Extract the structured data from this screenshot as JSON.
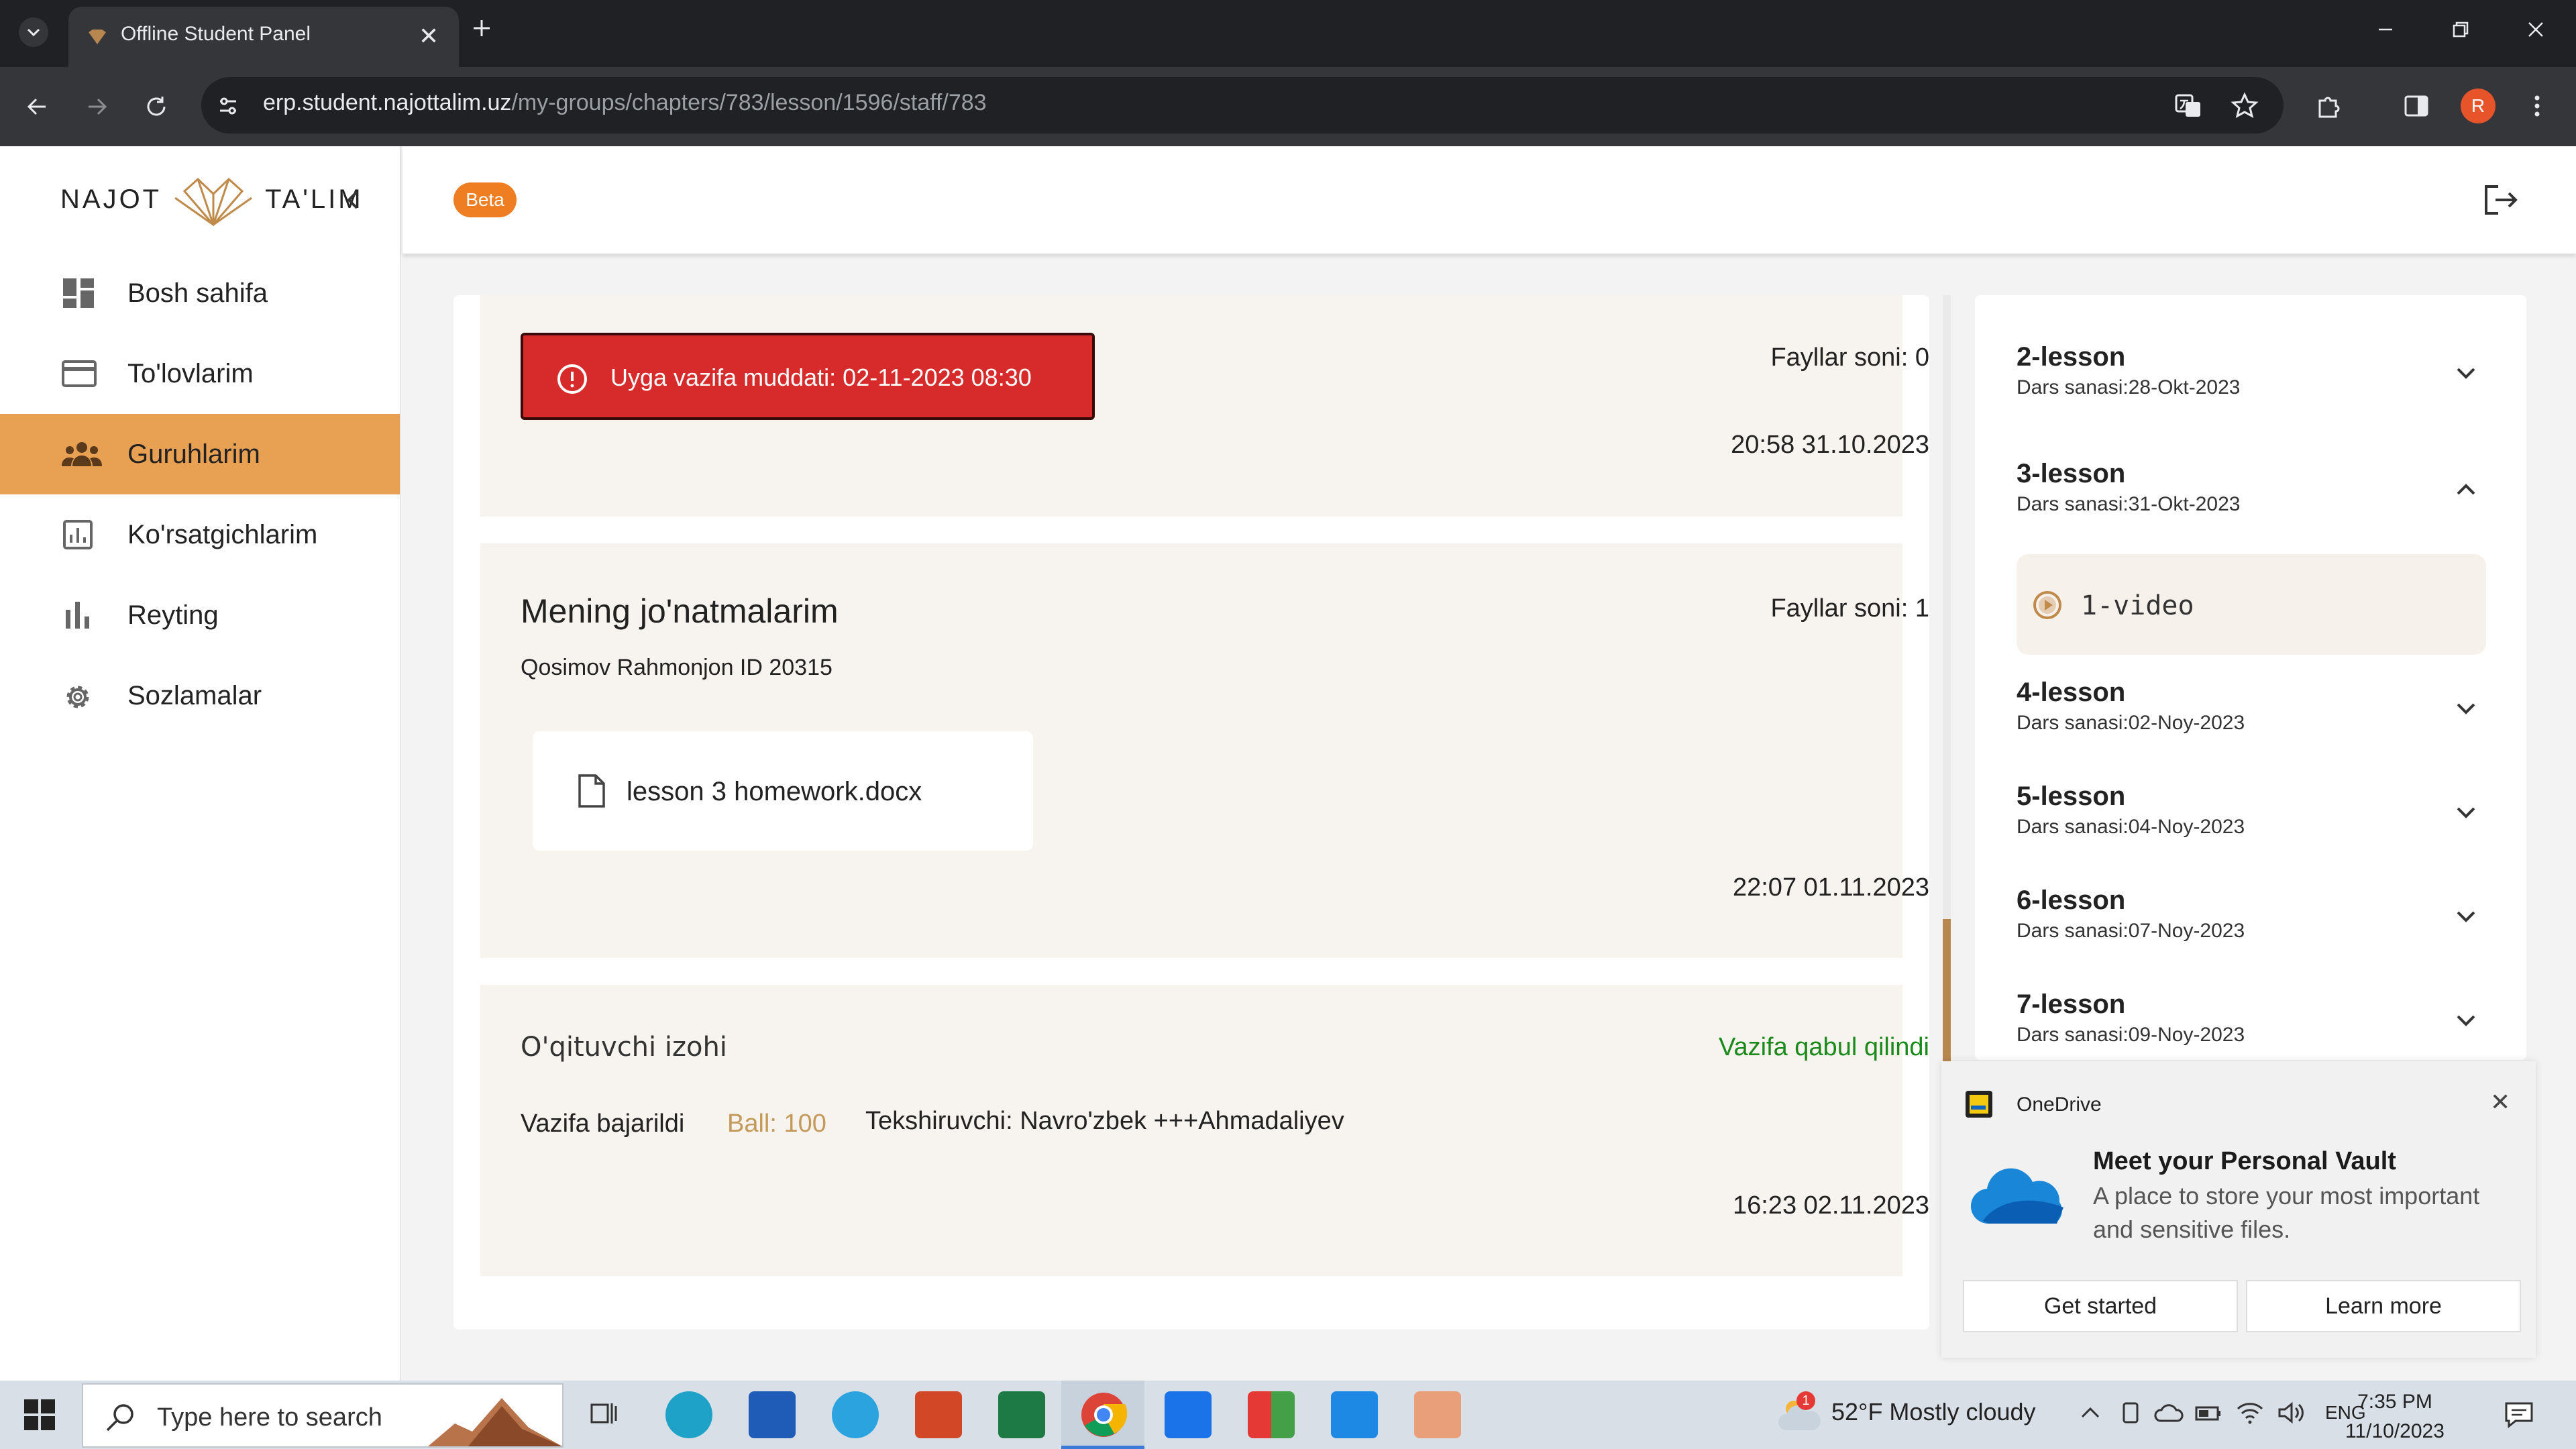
{
  "browser": {
    "tab_title": "Offline Student Panel",
    "tab_close": "✕",
    "url_host": "erp.student.najottalim.uz",
    "url_path": "/my-groups/chapters/783/lesson/1596/staff/783",
    "profile_initial": "R"
  },
  "app": {
    "logo_left": "NAJOT",
    "logo_right": "TA'LIM",
    "beta_badge": "Beta",
    "accent_color": "#e8a053",
    "sidebar": [
      {
        "label": "Bosh sahifa",
        "icon": "dashboard-icon"
      },
      {
        "label": "To'lovlarim",
        "icon": "card-icon"
      },
      {
        "label": "Guruhlarim",
        "icon": "group-icon",
        "active": true
      },
      {
        "label": "Ko'rsatgichlarim",
        "icon": "stats-icon"
      },
      {
        "label": "Reyting",
        "icon": "bar-chart-icon"
      },
      {
        "label": "Sozlamalar",
        "icon": "gear-icon"
      }
    ]
  },
  "homework": {
    "deadline_text": "Uyga vazifa muddati: 02-11-2023 08:30",
    "files_count_label": "Fayllar soni: 0",
    "created_at": "20:58 31.10.2023"
  },
  "submissions": {
    "title": "Mening jo'natmalarim",
    "files_count_label": "Fayllar soni: 1",
    "student": "Qosimov Rahmonjon ID 20315",
    "file_name": "lesson 3 homework.docx",
    "submitted_at": "22:07 01.11.2023"
  },
  "review": {
    "title": "O'qituvchi izohi",
    "status": "Vazifa qabul qilindi",
    "status_color": "#1a8a1a",
    "comment": "Vazifa bajarildi",
    "score": "Ball: 100",
    "reviewer": "Tekshiruvchi: Navro'zbek +++Ahmadaliyev",
    "reviewed_at": "16:23 02.11.2023"
  },
  "lessons": [
    {
      "title": "2-lesson",
      "date": "Dars sanasi:28-Okt-2023",
      "expanded": false
    },
    {
      "title": "3-lesson",
      "date": "Dars sanasi:31-Okt-2023",
      "expanded": true
    },
    {
      "title": "4-lesson",
      "date": "Dars sanasi:02-Noy-2023",
      "expanded": false
    },
    {
      "title": "5-lesson",
      "date": "Dars sanasi:04-Noy-2023",
      "expanded": false
    },
    {
      "title": "6-lesson",
      "date": "Dars sanasi:07-Noy-2023",
      "expanded": false
    },
    {
      "title": "7-lesson",
      "date": "Dars sanasi:09-Noy-2023",
      "expanded": false
    }
  ],
  "lesson_video": "1-video",
  "onedrive": {
    "app": "OneDrive",
    "heading": "Meet your Personal Vault",
    "body": "A place to store your most important and sensitive files.",
    "primary_button": "Get started",
    "secondary_button": "Learn more"
  },
  "taskbar": {
    "search_placeholder": "Type here to search",
    "weather_badge": "1",
    "weather": "52°F  Mostly cloudy",
    "language": "ENG",
    "time": "7:35 PM",
    "date": "11/10/2023"
  }
}
